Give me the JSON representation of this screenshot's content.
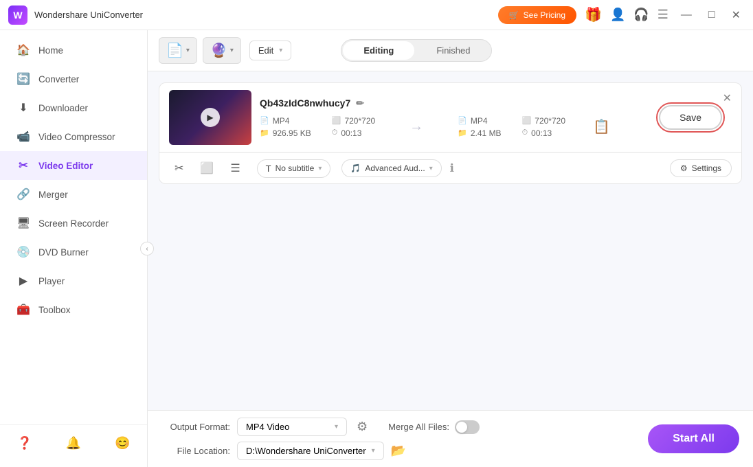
{
  "titleBar": {
    "appName": "Wondershare UniConverter",
    "seePricingLabel": "See Pricing",
    "winButtons": [
      "—",
      "□",
      "✕"
    ]
  },
  "sidebar": {
    "items": [
      {
        "id": "home",
        "icon": "🏠",
        "label": "Home"
      },
      {
        "id": "converter",
        "icon": "🔄",
        "label": "Converter"
      },
      {
        "id": "downloader",
        "icon": "⬇",
        "label": "Downloader"
      },
      {
        "id": "video-compressor",
        "icon": "📹",
        "label": "Video Compressor"
      },
      {
        "id": "video-editor",
        "icon": "✂",
        "label": "Video Editor",
        "active": true
      },
      {
        "id": "merger",
        "icon": "🔗",
        "label": "Merger"
      },
      {
        "id": "screen-recorder",
        "icon": "🖥",
        "label": "Screen Recorder"
      },
      {
        "id": "dvd-burner",
        "icon": "💿",
        "label": "DVD Burner"
      },
      {
        "id": "player",
        "icon": "▶",
        "label": "Player"
      },
      {
        "id": "toolbox",
        "icon": "🧰",
        "label": "Toolbox"
      }
    ],
    "bottomIcons": [
      "❓",
      "🔔",
      "😊"
    ]
  },
  "toolbar": {
    "addVideoLabel": "➕",
    "addMenu": "🔽",
    "editLabel": "Edit",
    "tabEditing": "Editing",
    "tabFinished": "Finished"
  },
  "videoItem": {
    "filename": "Qb43zIdC8nwhucy7",
    "sourceFormat": "MP4",
    "sourceResolution": "720*720",
    "sourceSize": "926.95 KB",
    "sourceDuration": "00:13",
    "outputFormat": "MP4",
    "outputResolution": "720*720",
    "outputSize": "2.41 MB",
    "outputDuration": "00:13",
    "subtitleLabel": "No subtitle",
    "audioLabel": "Advanced Aud...",
    "settingsLabel": "Settings",
    "saveLabel": "Save"
  },
  "bottomBar": {
    "outputFormatLabel": "Output Format:",
    "outputFormatValue": "MP4 Video",
    "fileLocationLabel": "File Location:",
    "fileLocationValue": "D:\\Wondershare UniConverter",
    "mergeAllLabel": "Merge All Files:",
    "startAllLabel": "Start All"
  }
}
